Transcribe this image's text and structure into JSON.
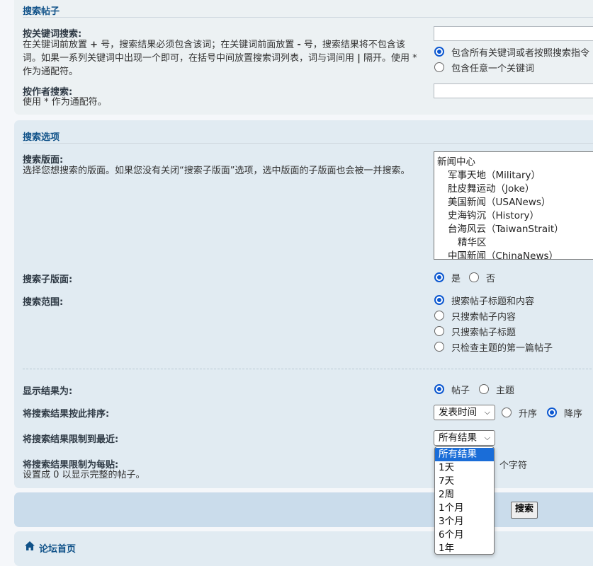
{
  "search_posts": {
    "title": "搜索帖子",
    "keywords_label": "按关键词搜索:",
    "keywords_desc_part1": "在关键词前放置",
    "keywords_plus": "+",
    "keywords_desc_part2": "号，搜索结果必须包含该词；在关键词前面放置",
    "keywords_minus": "-",
    "keywords_desc_part3": "号，搜索结果将不包含该词。如果一系列关键词中出现一个即可，在括号中间放置搜索词列表，词与词间用",
    "keywords_pipe": "|",
    "keywords_desc_part4": "隔开。使用 * 作为通配符。",
    "keywords_value": "",
    "terms_all": "包含所有关键词或者按照搜索指令",
    "terms_any": "包含任意一个关键词",
    "author_label": "按作者搜索:",
    "author_desc": "使用 * 作为通配符。",
    "author_value": ""
  },
  "search_options": {
    "title": "搜索选项",
    "forums_label": "搜索版面:",
    "forums_desc": "选择您想搜索的版面。如果您没有关闭“搜索子版面”选项，选中版面的子版面也会被一并搜索。",
    "forums": [
      {
        "label": "新闻中心",
        "level": 0
      },
      {
        "label": "军事天地（Military）",
        "level": 1
      },
      {
        "label": "肚皮舞运动（Joke）",
        "level": 1
      },
      {
        "label": "美国新闻（USANews）",
        "level": 1
      },
      {
        "label": "史海钩沉（History）",
        "level": 1
      },
      {
        "label": "台海风云（TaiwanStrait）",
        "level": 1
      },
      {
        "label": "精华区",
        "level": 2
      },
      {
        "label": "中国新闻（ChinaNews）",
        "level": 1
      }
    ],
    "subforums_label": "搜索子版面:",
    "yes": "是",
    "no": "否",
    "scope_label": "搜索范围:",
    "scope_options": [
      "搜索帖子标题和内容",
      "只搜索帖子内容",
      "只搜索帖子标题",
      "只检查主题的第一篇帖子"
    ],
    "display_label": "显示结果为:",
    "display_posts": "帖子",
    "display_topics": "主题",
    "sort_label": "将搜索结果按此排序:",
    "sort_value": "发表时间",
    "asc": "升序",
    "desc": "降序",
    "limit_label": "将搜索结果限制到最近:",
    "limit_value": "所有结果",
    "chars_label": "将搜索结果限制为每贴:",
    "chars_desc": "设置成 0 以显示完整的帖子。",
    "chars_unit": "个字符"
  },
  "limit_dropdown": {
    "options": [
      "所有结果",
      "1天",
      "7天",
      "2周",
      "1个月",
      "3个月",
      "6个月",
      "1年"
    ],
    "selected": 0
  },
  "actions": {
    "search_button": "搜索"
  },
  "footer": {
    "home_label": "论坛首页"
  },
  "colors": {
    "accent": "#0b57d0",
    "title": "#105289",
    "panel": "#ecf1f3",
    "panel_alt": "#e1ebf2"
  },
  "icons": {
    "home": "home-icon",
    "chevron": "chevron-down-icon"
  }
}
